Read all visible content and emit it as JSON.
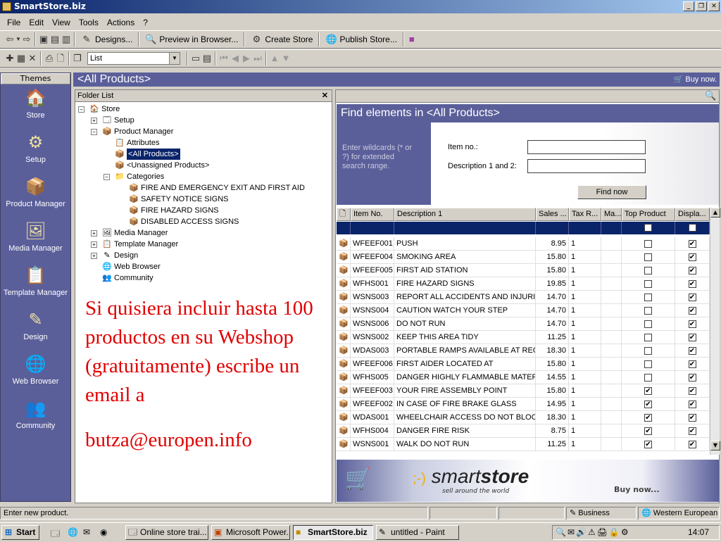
{
  "window": {
    "title": "SmartStore.biz",
    "btn_min": "_",
    "btn_max": "❐",
    "btn_close": "✕"
  },
  "menu": [
    "File",
    "Edit",
    "View",
    "Tools",
    "Actions",
    "?"
  ],
  "toolbar1": {
    "designs": "Designs...",
    "preview": "Preview in Browser...",
    "create": "Create Store",
    "publish": "Publish Store..."
  },
  "toolbar2": {
    "view_select": "List"
  },
  "themes": {
    "header": "Themes",
    "items": [
      {
        "label": "Store",
        "icon": "🏠"
      },
      {
        "label": "Setup",
        "icon": "⚙"
      },
      {
        "label": "Product Manager",
        "icon": "📦"
      },
      {
        "label": "Media Manager",
        "icon": "🖼"
      },
      {
        "label": "Template Manager",
        "icon": "📋"
      },
      {
        "label": "Design",
        "icon": "✎"
      },
      {
        "label": "Web Browser",
        "icon": "🌐"
      },
      {
        "label": "Community",
        "icon": "👥"
      }
    ]
  },
  "page": {
    "title": "<All Products>",
    "buynow": "Buy now."
  },
  "folder": {
    "header": "Folder List",
    "close": "✕",
    "nodes": [
      {
        "label": "Store",
        "exp": "−",
        "icon": "🏠"
      },
      {
        "label": "Setup",
        "exp": "+",
        "icon": "🗔"
      },
      {
        "label": "Product Manager",
        "exp": "−",
        "icon": "📦"
      },
      {
        "label": "Attributes",
        "exp": "",
        "icon": "📋"
      },
      {
        "label": "<All Products>",
        "exp": "",
        "icon": "📦"
      },
      {
        "label": "<Unassigned Products>",
        "exp": "",
        "icon": "📦"
      },
      {
        "label": "Categories",
        "exp": "−",
        "icon": "📁"
      },
      {
        "label": "FIRE AND EMERGENCY EXIT AND FIRST AID",
        "exp": "",
        "icon": "📦"
      },
      {
        "label": "SAFETY NOTICE SIGNS",
        "exp": "",
        "icon": "📦"
      },
      {
        "label": "FIRE HAZARD SIGNS",
        "exp": "",
        "icon": "📦"
      },
      {
        "label": "DISABLED ACCESS SIGNS",
        "exp": "",
        "icon": "📦"
      },
      {
        "label": "Media Manager",
        "exp": "+",
        "icon": "🖼"
      },
      {
        "label": "Template Manager",
        "exp": "+",
        "icon": "📋"
      },
      {
        "label": "Design",
        "exp": "+",
        "icon": "✎"
      },
      {
        "label": "Web Browser",
        "exp": "",
        "icon": "🌐"
      },
      {
        "label": "Community",
        "exp": "",
        "icon": "👥"
      }
    ]
  },
  "overlay": {
    "line1": "Si  quisiera incluir hasta 100 productos en su Webshop (gratuitamente) escribe un email a",
    "line2": "butza@europen.info"
  },
  "find": {
    "title": "Find elements in <All Products>",
    "hint": "Enter wildcards (* or ?) for extended search range.",
    "item_label": "Item no.:",
    "desc_label": "Description 1 and 2:",
    "button": "Find now"
  },
  "grid": {
    "headers": [
      "Item No.",
      "Description 1",
      "Sales ...",
      "Tax R...",
      "Ma...",
      "Top Product",
      "Displa..."
    ],
    "rows": [
      [
        "WFEEF001",
        "PUSH",
        "8.95",
        "1",
        false,
        true
      ],
      [
        "WFEEF004",
        "SMOKING AREA",
        "15.80",
        "1",
        false,
        true
      ],
      [
        "WFEEF005",
        "FIRST AID STATION",
        "15.80",
        "1",
        false,
        true
      ],
      [
        "WFHS001",
        "FIRE HAZARD SIGNS",
        "19.85",
        "1",
        false,
        true
      ],
      [
        "WSNS003",
        "REPORT ALL ACCIDENTS AND INJURIES",
        "14.70",
        "1",
        false,
        true
      ],
      [
        "WSNS004",
        "CAUTION WATCH YOUR STEP",
        "14.70",
        "1",
        false,
        true
      ],
      [
        "WSNS006",
        "DO NOT RUN",
        "14.70",
        "1",
        false,
        true
      ],
      [
        "WSNS002",
        "KEEP THIS AREA TIDY",
        "11.25",
        "1",
        false,
        true
      ],
      [
        "WDAS003",
        "PORTABLE RAMPS AVAILABLE AT REC...",
        "18.30",
        "1",
        false,
        true
      ],
      [
        "WFEEF006",
        "FIRST AIDER LOCATED AT",
        "15.80",
        "1",
        false,
        true
      ],
      [
        "WFHS005",
        "DANGER HIGHLY FLAMMABLE MATERIAL",
        "14.55",
        "1",
        false,
        true
      ],
      [
        "WFEEF003",
        "YOUR FIRE ASSEMBLY POINT",
        "15.80",
        "1",
        true,
        true
      ],
      [
        "WFEEF002",
        "IN CASE OF FIRE BRAKE GLASS",
        "14.95",
        "1",
        true,
        true
      ],
      [
        "WDAS001",
        "WHEELCHAIR ACCESS DO NOT BLOC...",
        "18.30",
        "1",
        true,
        true
      ],
      [
        "WFHS004",
        "DANGER FIRE RISK",
        "8.75",
        "1",
        true,
        true
      ],
      [
        "WSNS001",
        "WALK DO NOT RUN",
        "11.25",
        "1",
        true,
        true
      ]
    ]
  },
  "banner": {
    "brand_a": "smart",
    "brand_b": "store",
    "tagline": "sell around the world",
    "buynow": "Buy now..."
  },
  "status": {
    "text": "Enter new product.",
    "business": "Business",
    "region": "Western European"
  },
  "taskbar": {
    "start": "Start",
    "tasks": [
      "Online store trai...",
      "Microsoft Power...",
      "SmartStore.biz",
      "untitled - Paint"
    ],
    "clock": "14:07"
  }
}
